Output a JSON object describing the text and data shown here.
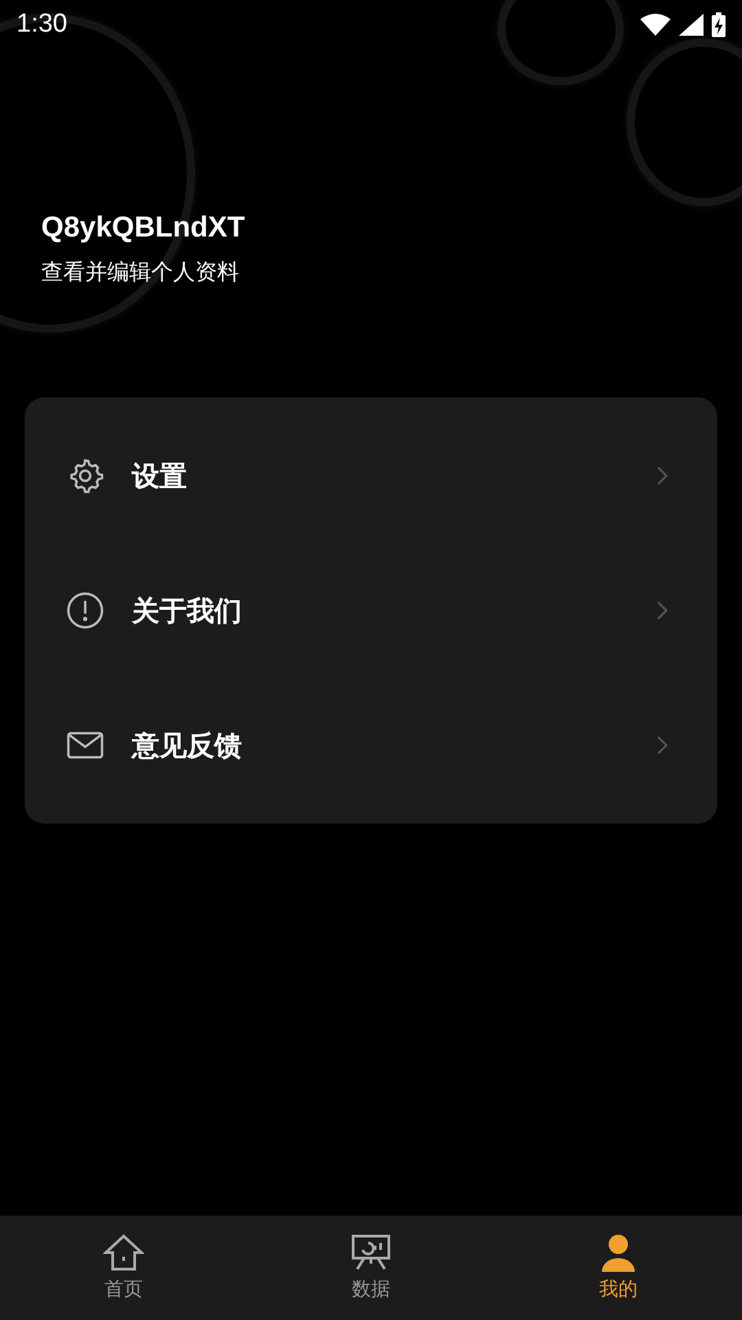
{
  "status_bar": {
    "time": "1:30"
  },
  "profile": {
    "name": "Q8ykQBLndXT",
    "subtitle": "查看并编辑个人资料"
  },
  "menu": [
    {
      "kind": "settings",
      "label": "设置"
    },
    {
      "kind": "info",
      "label": "关于我们"
    },
    {
      "kind": "mail",
      "label": "意见反馈"
    }
  ],
  "tabs": [
    {
      "kind": "home",
      "label": "首页",
      "selected": false
    },
    {
      "kind": "data",
      "label": "数据",
      "selected": false
    },
    {
      "kind": "profile",
      "label": "我的",
      "selected": true
    }
  ]
}
